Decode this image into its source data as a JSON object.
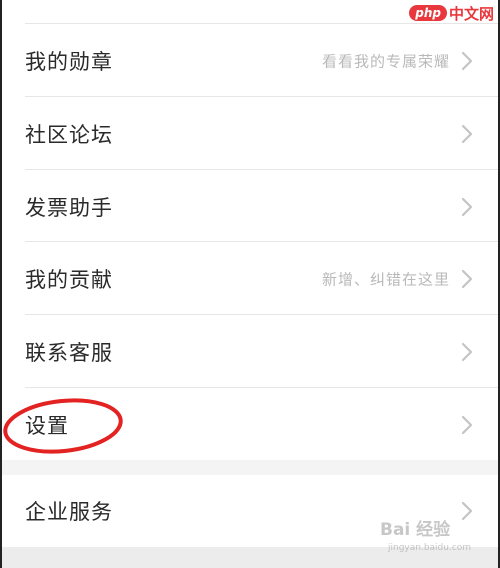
{
  "watermark_top": {
    "logo": "php",
    "site": "中文网"
  },
  "watermark_bottom": {
    "brand": "Bai 经验",
    "url": "jingyan.baidu.com"
  },
  "menu": {
    "items": [
      {
        "label": "我的勋章",
        "hint": "看看我的专属荣耀"
      },
      {
        "label": "社区论坛",
        "hint": ""
      },
      {
        "label": "发票助手",
        "hint": ""
      },
      {
        "label": "我的贡献",
        "hint": "新增、纠错在这里"
      },
      {
        "label": "联系客服",
        "hint": ""
      },
      {
        "label": "设置",
        "hint": ""
      }
    ],
    "bottom_items": [
      {
        "label": "企业服务",
        "hint": ""
      }
    ]
  },
  "colors": {
    "annotation_circle": "#e32222",
    "chevron": "#c4c4c4",
    "background": "#f4f4f4"
  },
  "icons": {
    "chevron": "chevron-right-icon"
  }
}
